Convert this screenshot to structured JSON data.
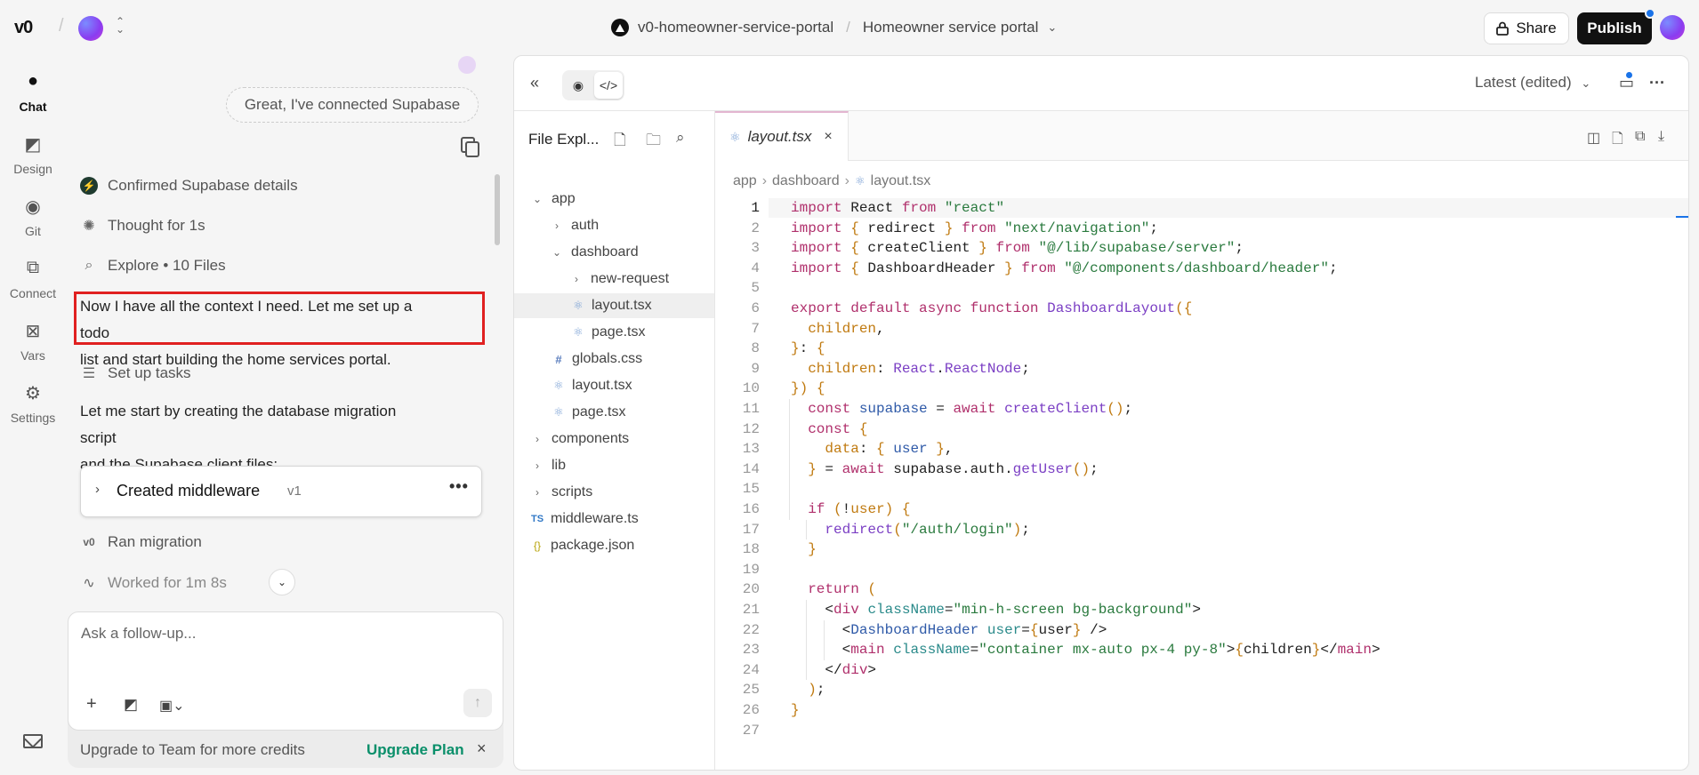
{
  "topbar": {
    "logo": "v0",
    "project_name": "v0-homeowner-service-portal",
    "chat_title": "Homeowner service portal",
    "share_label": "Share",
    "publish_label": "Publish"
  },
  "rail": {
    "items": [
      {
        "label": "Chat",
        "icon": "chat-icon",
        "active": true
      },
      {
        "label": "Design",
        "icon": "design-icon"
      },
      {
        "label": "Git",
        "icon": "github-icon"
      },
      {
        "label": "Connect",
        "icon": "connect-icon"
      },
      {
        "label": "Vars",
        "icon": "vars-icon"
      },
      {
        "label": "Settings",
        "icon": "gear-icon"
      }
    ],
    "bottom_icon": "mail-icon"
  },
  "chat": {
    "user_message": "Great, I've connected Supabase",
    "steps": {
      "confirmed": "Confirmed Supabase details",
      "thought": "Thought for 1s",
      "explore": "Explore • 10 Files",
      "tasks": "Set up tasks",
      "migration": "Ran migration",
      "worked": "Worked for 1m 8s"
    },
    "para1_line1": "Now I have all the context I need. Let me set up a todo",
    "para1_line2": "list and start building the home services portal.",
    "para2_line1": "Let me start by creating the database migration script",
    "para2_line2": "and the Supabase client files:",
    "artifact": {
      "title": "Created middleware",
      "version": "v1",
      "more": "•••"
    },
    "composer_placeholder": "Ask a follow-up...",
    "upgrade_text": "Upgrade to Team for more credits",
    "upgrade_link": "Upgrade Plan"
  },
  "workspace": {
    "version_label": "Latest (edited)",
    "explorer_title": "File Expl...",
    "tree": [
      {
        "label": "app",
        "type": "folder",
        "open": true,
        "depth": 0
      },
      {
        "label": "auth",
        "type": "folder",
        "open": false,
        "depth": 1
      },
      {
        "label": "dashboard",
        "type": "folder",
        "open": true,
        "depth": 1
      },
      {
        "label": "new-request",
        "type": "folder",
        "open": false,
        "depth": 2
      },
      {
        "label": "layout.tsx",
        "type": "react",
        "depth": 2,
        "selected": true
      },
      {
        "label": "page.tsx",
        "type": "react",
        "depth": 2
      },
      {
        "label": "globals.css",
        "type": "css",
        "depth": 1
      },
      {
        "label": "layout.tsx",
        "type": "react",
        "depth": 1
      },
      {
        "label": "page.tsx",
        "type": "react",
        "depth": 1
      },
      {
        "label": "components",
        "type": "folder",
        "open": false,
        "depth": 0
      },
      {
        "label": "lib",
        "type": "folder",
        "open": false,
        "depth": 0
      },
      {
        "label": "scripts",
        "type": "folder",
        "open": false,
        "depth": 0
      },
      {
        "label": "middleware.ts",
        "type": "ts",
        "depth": 0
      },
      {
        "label": "package.json",
        "type": "json",
        "depth": 0
      }
    ],
    "tab_name": "layout.tsx",
    "breadcrumb": [
      "app",
      "dashboard",
      "layout.tsx"
    ],
    "current_line": 1,
    "code_lines": [
      "import React from \"react\"",
      "import { redirect } from \"next/navigation\";",
      "import { createClient } from \"@/lib/supabase/server\";",
      "import { DashboardHeader } from \"@/components/dashboard/header\";",
      "",
      "export default async function DashboardLayout({",
      "  children,",
      "}: {",
      "  children: React.ReactNode;",
      "}) {",
      "  const supabase = await createClient();",
      "  const {",
      "    data: { user },",
      "  } = await supabase.auth.getUser();",
      "",
      "  if (!user) {",
      "    redirect(\"/auth/login\");",
      "  }",
      "",
      "  return (",
      "    <div className=\"min-h-screen bg-background\">",
      "      <DashboardHeader user={user} />",
      "      <main className=\"container mx-auto px-4 py-8\">{children}</main>",
      "    </div>",
      "  );",
      "}",
      ""
    ]
  }
}
